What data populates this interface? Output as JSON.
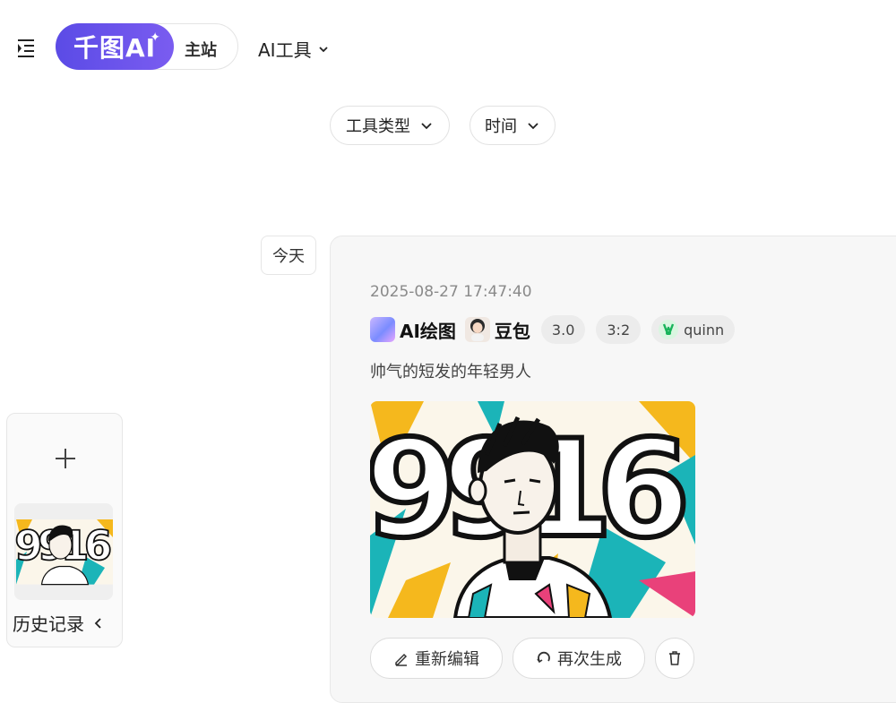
{
  "header": {
    "logo_text": "千图AI",
    "main_site_label": "主站",
    "ai_tools_label": "AI工具"
  },
  "filters": {
    "tool_type_label": "工具类型",
    "time_label": "时间"
  },
  "feed": {
    "date_group": "今天",
    "item": {
      "timestamp": "2025-08-27 17:47:40",
      "app_name": "AI绘图",
      "model_name": "豆包",
      "version": "3.0",
      "ratio": "3:2",
      "user": "quinn",
      "prompt": "帅气的短发的年轻男人",
      "image_text": "9916"
    },
    "actions": {
      "edit_label": "重新编辑",
      "regenerate_label": "再次生成"
    }
  },
  "sidebar": {
    "history_label": "历史记录"
  },
  "icons": {
    "menu": "menu-indent-icon",
    "chevron": "chevron-down-icon",
    "edit": "pencil-icon",
    "regenerate": "refresh-icon",
    "delete": "trash-icon",
    "plus": "plus-icon",
    "collapse": "chevron-left-icon"
  },
  "colors": {
    "brand": "#6c5ce7",
    "card_bg": "#f7f7f7"
  }
}
